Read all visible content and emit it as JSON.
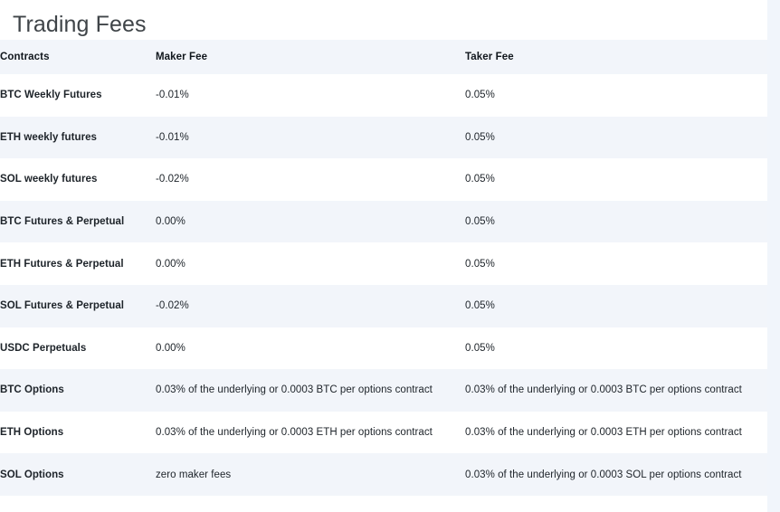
{
  "page": {
    "title": "Trading Fees"
  },
  "table": {
    "columns": [
      {
        "key": "contract",
        "label": "Contracts"
      },
      {
        "key": "maker",
        "label": "Maker Fee"
      },
      {
        "key": "taker",
        "label": "Taker Fee"
      }
    ],
    "rows": [
      {
        "contract": "BTC Weekly Futures",
        "maker": "-0.01%",
        "taker": "0.05%"
      },
      {
        "contract": "ETH weekly futures",
        "maker": "-0.01%",
        "taker": "0.05%"
      },
      {
        "contract": "SOL weekly futures",
        "maker": "-0.02%",
        "taker": "0.05%"
      },
      {
        "contract": "BTC Futures & Perpetual",
        "maker": "0.00%",
        "taker": "0.05%"
      },
      {
        "contract": "ETH Futures & Perpetual",
        "maker": "0.00%",
        "taker": "0.05%"
      },
      {
        "contract": "SOL Futures & Perpetual",
        "maker": "-0.02%",
        "taker": "0.05%"
      },
      {
        "contract": "USDC Perpetuals",
        "maker": "0.00%",
        "taker": "0.05%"
      },
      {
        "contract": "BTC Options",
        "maker": "0.03% of the underlying or 0.0003 BTC per options contract",
        "taker": "0.03% of the underlying or 0.0003 BTC per options contract"
      },
      {
        "contract": "ETH Options",
        "maker": "0.03% of the underlying or 0.0003 ETH per options contract",
        "taker": "0.03% of the underlying or 0.0003 ETH per options contract"
      },
      {
        "contract": "SOL Options",
        "maker": "zero maker fees",
        "taker": "0.03% of the underlying or 0.0003 SOL per options contract"
      }
    ]
  },
  "colors": {
    "header_row_bg": "#f2f5fa",
    "stripe_bg": "#f2f5fa",
    "row_bg": "#ffffff",
    "page_bg": "#ffffff",
    "gutter_bg": "#f1f5fb",
    "title_text": "#3f4448",
    "heading_text": "#10161c",
    "value_text": "#2b3138"
  }
}
